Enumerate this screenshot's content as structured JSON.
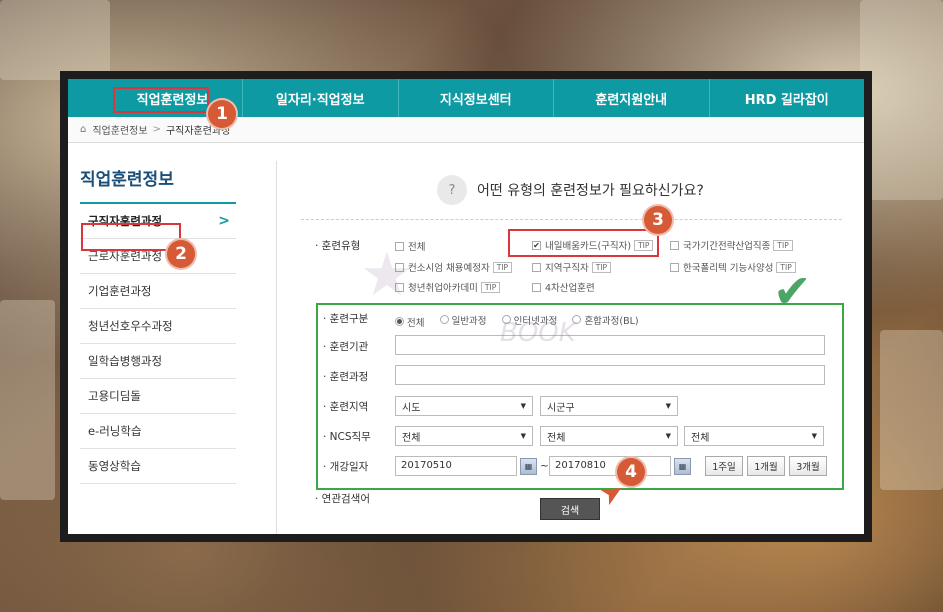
{
  "nav": {
    "items": [
      "직업훈련정보",
      "일자리·직업정보",
      "지식정보센터",
      "훈련지원안내",
      "HRD 길라잡이"
    ]
  },
  "breadcrumb": {
    "home_icon": "home-icon",
    "items": [
      "직업훈련정보",
      "구직자훈련과정"
    ],
    "separator": ">"
  },
  "sidebar": {
    "title": "직업훈련정보",
    "items": [
      "구직자훈련과정",
      "근로자훈련과정",
      "기업훈련과정",
      "청년선호우수과정",
      "일학습병행과정",
      "고용디딤돌",
      "e-러닝학습",
      "동영상학습"
    ],
    "active_chevron": ">"
  },
  "content": {
    "question": "어떤 유형의 훈련정보가 필요하신가요?",
    "question_icon": "?",
    "training_type": {
      "label": "· 훈련유형",
      "options": [
        {
          "label": "전체",
          "checked": false,
          "tip": false
        },
        {
          "label": "내일배움카드(구직자)",
          "checked": true,
          "tip": true
        },
        {
          "label": "국가기간전략산업직종",
          "checked": false,
          "tip": true
        },
        {
          "label": "컨소시엄 채용예정자",
          "checked": false,
          "tip": true
        },
        {
          "label": "지역구직자",
          "checked": false,
          "tip": true
        },
        {
          "label": "한국폴리텍 기능사양성",
          "checked": false,
          "tip": true
        },
        {
          "label": "청년취업아카데미",
          "checked": false,
          "tip": true
        },
        {
          "label": "4차산업훈련",
          "checked": false,
          "tip": false
        }
      ],
      "tip_text": "TIP"
    },
    "training_category": {
      "label": "· 훈련구분",
      "options": [
        "전체",
        "일반과정",
        "인터넷과정",
        "혼합과정(BL)"
      ],
      "selected": "전체"
    },
    "institution": {
      "label": "· 훈련기관",
      "value": ""
    },
    "course": {
      "label": "· 훈련과정",
      "value": ""
    },
    "region": {
      "label": "· 훈련지역",
      "province": "시도",
      "district": "시군구"
    },
    "ncs": {
      "label": "· NCS직무",
      "values": [
        "전체",
        "전체",
        "전체"
      ]
    },
    "start_date": {
      "label": "· 개강일자",
      "from": "20170510",
      "tilde": "~",
      "to": "20170810",
      "periods": [
        "1주일",
        "1개월",
        "3개월"
      ]
    },
    "related_search": {
      "label": "· 연관검색어"
    },
    "search_button": "검색"
  },
  "annotations": {
    "badges": [
      "1",
      "2",
      "3",
      "4"
    ],
    "check_color": "#4aa566",
    "badge_color": "#d65a35",
    "box_color": "#d9363e"
  },
  "watermark": "BOOK",
  "colors": {
    "nav": "#0d9aa3",
    "highlight": "#3aa845"
  }
}
